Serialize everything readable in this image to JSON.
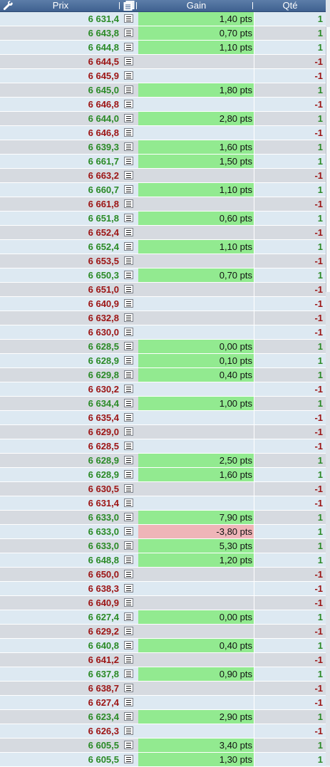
{
  "header": {
    "settings_icon": "wrench-icon",
    "prix_label": "Prix",
    "detail_icon": "document-icon",
    "gain_label": "Gain",
    "qte_label": "Qté"
  },
  "colors": {
    "header_bg": "#4a6c9b",
    "buy_text": "#2a8a26",
    "sell_text": "#9c1414",
    "gain_positive_bg": "#92ea90",
    "gain_negative_bg": "#efb5b8"
  },
  "trades": [
    {
      "prix": "6 631,4",
      "gain": "1,40 pts",
      "qte": "1"
    },
    {
      "prix": "6 643,8",
      "gain": "0,70 pts",
      "qte": "1"
    },
    {
      "prix": "6 644,8",
      "gain": "1,10 pts",
      "qte": "1"
    },
    {
      "prix": "6 644,5",
      "gain": "",
      "qte": "-1"
    },
    {
      "prix": "6 645,9",
      "gain": "",
      "qte": "-1"
    },
    {
      "prix": "6 645,0",
      "gain": "1,80 pts",
      "qte": "1"
    },
    {
      "prix": "6 646,8",
      "gain": "",
      "qte": "-1"
    },
    {
      "prix": "6 644,0",
      "gain": "2,80 pts",
      "qte": "1"
    },
    {
      "prix": "6 646,8",
      "gain": "",
      "qte": "-1"
    },
    {
      "prix": "6 639,3",
      "gain": "1,60 pts",
      "qte": "1"
    },
    {
      "prix": "6 661,7",
      "gain": "1,50 pts",
      "qte": "1"
    },
    {
      "prix": "6 663,2",
      "gain": "",
      "qte": "-1"
    },
    {
      "prix": "6 660,7",
      "gain": "1,10 pts",
      "qte": "1"
    },
    {
      "prix": "6 661,8",
      "gain": "",
      "qte": "-1"
    },
    {
      "prix": "6 651,8",
      "gain": "0,60 pts",
      "qte": "1"
    },
    {
      "prix": "6 652,4",
      "gain": "",
      "qte": "-1"
    },
    {
      "prix": "6 652,4",
      "gain": "1,10 pts",
      "qte": "1"
    },
    {
      "prix": "6 653,5",
      "gain": "",
      "qte": "-1"
    },
    {
      "prix": "6 650,3",
      "gain": "0,70 pts",
      "qte": "1"
    },
    {
      "prix": "6 651,0",
      "gain": "",
      "qte": "-1"
    },
    {
      "prix": "6 640,9",
      "gain": "",
      "qte": "-1"
    },
    {
      "prix": "6 632,8",
      "gain": "",
      "qte": "-1"
    },
    {
      "prix": "6 630,0",
      "gain": "",
      "qte": "-1"
    },
    {
      "prix": "6 628,5",
      "gain": "0,00 pts",
      "qte": "1"
    },
    {
      "prix": "6 628,9",
      "gain": "0,10 pts",
      "qte": "1"
    },
    {
      "prix": "6 629,8",
      "gain": "0,40 pts",
      "qte": "1"
    },
    {
      "prix": "6 630,2",
      "gain": "",
      "qte": "-1"
    },
    {
      "prix": "6 634,4",
      "gain": "1,00 pts",
      "qte": "1"
    },
    {
      "prix": "6 635,4",
      "gain": "",
      "qte": "-1"
    },
    {
      "prix": "6 629,0",
      "gain": "",
      "qte": "-1"
    },
    {
      "prix": "6 628,5",
      "gain": "",
      "qte": "-1"
    },
    {
      "prix": "6 628,9",
      "gain": "2,50 pts",
      "qte": "1"
    },
    {
      "prix": "6 628,9",
      "gain": "1,60 pts",
      "qte": "1"
    },
    {
      "prix": "6 630,5",
      "gain": "",
      "qte": "-1"
    },
    {
      "prix": "6 631,4",
      "gain": "",
      "qte": "-1"
    },
    {
      "prix": "6 633,0",
      "gain": "7,90 pts",
      "qte": "1"
    },
    {
      "prix": "6 633,0",
      "gain": "-3,80 pts",
      "qte": "1"
    },
    {
      "prix": "6 633,0",
      "gain": "5,30 pts",
      "qte": "1"
    },
    {
      "prix": "6 648,8",
      "gain": "1,20 pts",
      "qte": "1"
    },
    {
      "prix": "6 650,0",
      "gain": "",
      "qte": "-1"
    },
    {
      "prix": "6 638,3",
      "gain": "",
      "qte": "-1"
    },
    {
      "prix": "6 640,9",
      "gain": "",
      "qte": "-1"
    },
    {
      "prix": "6 627,4",
      "gain": "0,00 pts",
      "qte": "1"
    },
    {
      "prix": "6 629,2",
      "gain": "",
      "qte": "-1"
    },
    {
      "prix": "6 640,8",
      "gain": "0,40 pts",
      "qte": "1"
    },
    {
      "prix": "6 641,2",
      "gain": "",
      "qte": "-1"
    },
    {
      "prix": "6 637,8",
      "gain": "0,90 pts",
      "qte": "1"
    },
    {
      "prix": "6 638,7",
      "gain": "",
      "qte": "-1"
    },
    {
      "prix": "6 627,4",
      "gain": "",
      "qte": "-1"
    },
    {
      "prix": "6 623,4",
      "gain": "2,90 pts",
      "qte": "1"
    },
    {
      "prix": "6 626,3",
      "gain": "",
      "qte": "-1"
    },
    {
      "prix": "6 605,5",
      "gain": "3,40 pts",
      "qte": "1"
    },
    {
      "prix": "6 605,5",
      "gain": "1,30 pts",
      "qte": "1"
    }
  ]
}
